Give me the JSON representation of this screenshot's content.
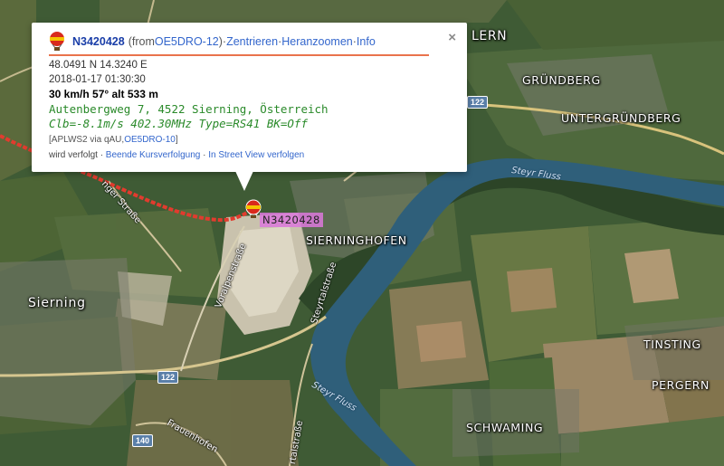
{
  "popup": {
    "callsign": "N3420428",
    "from_prefix": "(from ",
    "from_call": "OE5DRO-12",
    "from_suffix": ")",
    "sep": " · ",
    "link_center": "Zentrieren",
    "link_zoom": "Heranzoomen",
    "link_info": "Info",
    "close_glyph": "×",
    "coords": "48.0491 N 14.3240 E",
    "timestamp": "2018-01-17 01:30:30",
    "motion": "30 km/h 57° alt 533 m",
    "address": "Autenbergweg 7, 4522 Sierning, Österreich",
    "comment": "Clb=-8.1m/s 402.30MHz Type=RS41 BK=Off",
    "path_prefix": "[APLWS2 via qAU,",
    "path_call": "OE5DRO-10",
    "path_suffix": "]",
    "tracked_text": "wird verfolgt",
    "link_stop_tracking": "Beende Kursverfolgung",
    "link_streetview": "In Street View verfolgen"
  },
  "marker": {
    "label": "N3420428"
  },
  "places": {
    "lern": "LERN",
    "grundberg": "GRÜNDBERG",
    "untergrundberg": "UNTERGRÜNDBERG",
    "sierninghofen": "SIERNINGHOFEN",
    "sierning": "Sierning",
    "tinsting": "TINSTING",
    "pergern": "PERGERN",
    "schwaming": "SCHWAMING"
  },
  "roads": {
    "neustifter": "nger Straße",
    "voralpen": "Voralpenstraße",
    "seyrtal": "Steyrtalstraße",
    "frauenhofen": "Frauenhofen",
    "ortal": "rtalstraße"
  },
  "rivers": {
    "steyr_top": "Steyr Fluss",
    "steyr_bottom": "Steyr Fluss"
  },
  "shields": {
    "r122_top": "122",
    "r122_bottom": "122",
    "r140": "140"
  },
  "colors": {
    "track": "#e23b2e",
    "river": "#2f5f7a",
    "accent_line": "#e9734c",
    "link": "#3366cc",
    "comment_green": "#2a8a2a"
  }
}
